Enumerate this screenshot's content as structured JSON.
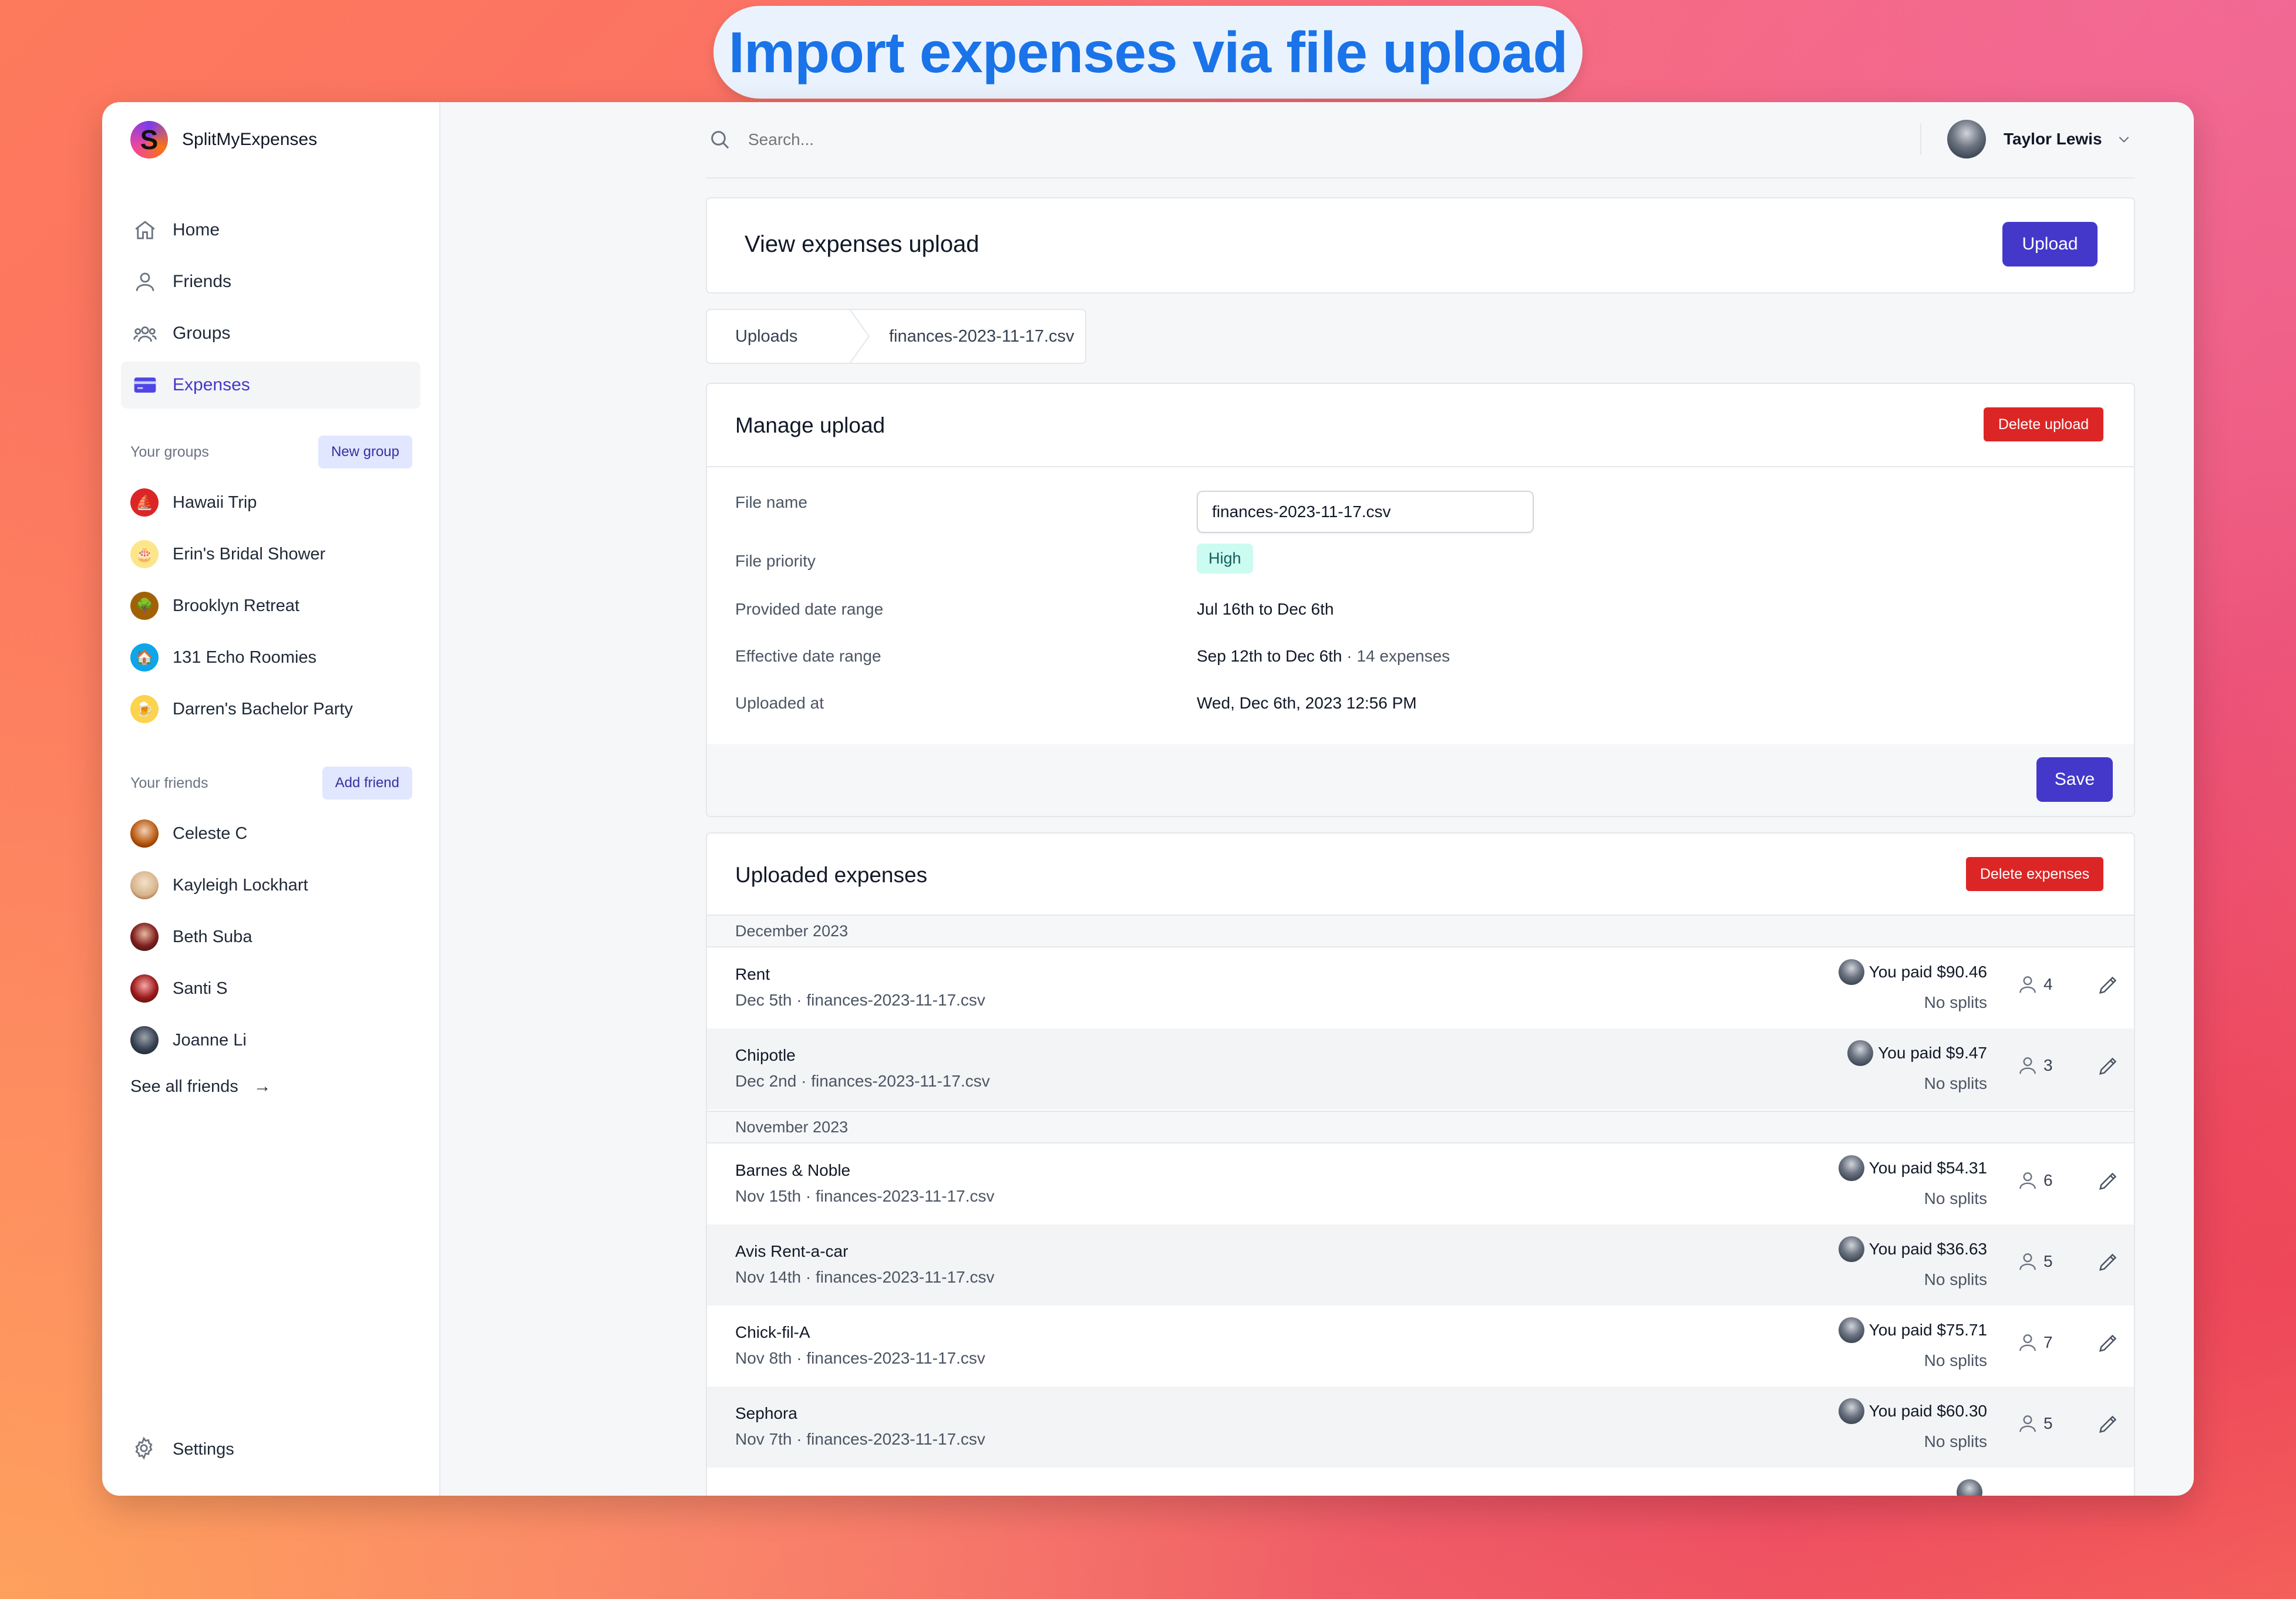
{
  "hero": {
    "title": "Import expenses via file upload"
  },
  "brand": {
    "logo_letter": "S",
    "name": "SplitMyExpenses"
  },
  "nav": [
    {
      "label": "Home",
      "icon": "home-icon",
      "active": false
    },
    {
      "label": "Friends",
      "icon": "user-icon",
      "active": false
    },
    {
      "label": "Groups",
      "icon": "users-icon",
      "active": false
    },
    {
      "label": "Expenses",
      "icon": "credit-card-icon",
      "active": true
    }
  ],
  "groups": {
    "label": "Your groups",
    "button": "New group",
    "items": [
      {
        "label": "Hawaii Trip",
        "color": "#dc2626",
        "glyph": "⛵"
      },
      {
        "label": "Erin's Bridal Shower",
        "color": "#fde68a",
        "glyph": "🎂"
      },
      {
        "label": "Brooklyn Retreat",
        "color": "#a16207",
        "glyph": "🌳"
      },
      {
        "label": "131 Echo Roomies",
        "color": "#0ea5e9",
        "glyph": "🏠"
      },
      {
        "label": "Darren's Bachelor Party",
        "color": "#fcd34d",
        "glyph": "🍺"
      }
    ]
  },
  "friends": {
    "label": "Your friends",
    "button": "Add friend",
    "items": [
      {
        "label": "Celeste C",
        "color": "#b45309"
      },
      {
        "label": "Kayleigh Lockhart",
        "color": "#d6b38a"
      },
      {
        "label": "Beth Suba",
        "color": "#7f1d1d"
      },
      {
        "label": "Santi S",
        "color": "#991b1b"
      },
      {
        "label": "Joanne Li",
        "color": "#374151"
      }
    ],
    "see_all": "See all friends",
    "see_all_arrow": "→"
  },
  "settings": {
    "label": "Settings"
  },
  "topbar": {
    "search_placeholder": "Search...",
    "user_name": "Taylor Lewis"
  },
  "view": {
    "title": "View expenses upload",
    "upload_button": "Upload"
  },
  "breadcrumb": {
    "root": "Uploads",
    "current": "finances-2023-11-17.csv"
  },
  "manage": {
    "title": "Manage upload",
    "delete_button": "Delete upload",
    "file_name_label": "File name",
    "file_name_value": "finances-2023-11-17.csv",
    "priority_label": "File priority",
    "priority_value": "High",
    "provided_label": "Provided date range",
    "provided_value": "Jul 16th to Dec 6th",
    "effective_label": "Effective date range",
    "effective_value": "Sep 12th to Dec 6th",
    "effective_count": "· 14 expenses",
    "uploaded_label": "Uploaded at",
    "uploaded_value": "Wed, Dec 6th, 2023 12:56 PM",
    "save_button": "Save"
  },
  "expenses": {
    "title": "Uploaded expenses",
    "delete_button": "Delete expenses",
    "months": [
      "December 2023",
      "November 2023"
    ],
    "rows": [
      {
        "name": "Rent",
        "date": "Dec 5th",
        "file": "finances-2023-11-17.csv",
        "paid": "You paid $90.46",
        "splits": "No splits",
        "people": "4"
      },
      {
        "name": "Chipotle",
        "date": "Dec 2nd",
        "file": "finances-2023-11-17.csv",
        "paid": "You paid $9.47",
        "splits": "No splits",
        "people": "3"
      },
      {
        "name": "Barnes & Noble",
        "date": "Nov 15th",
        "file": "finances-2023-11-17.csv",
        "paid": "You paid $54.31",
        "splits": "No splits",
        "people": "6"
      },
      {
        "name": "Avis Rent-a-car",
        "date": "Nov 14th",
        "file": "finances-2023-11-17.csv",
        "paid": "You paid $36.63",
        "splits": "No splits",
        "people": "5"
      },
      {
        "name": "Chick-fil-A",
        "date": "Nov 8th",
        "file": "finances-2023-11-17.csv",
        "paid": "You paid $75.71",
        "splits": "No splits",
        "people": "7"
      },
      {
        "name": "Sephora",
        "date": "Nov 7th",
        "file": "finances-2023-11-17.csv",
        "paid": "You paid $60.30",
        "splits": "No splits",
        "people": "5"
      }
    ],
    "separator": "·"
  },
  "colors": {
    "primary": "#4338ca",
    "danger": "#dc2626",
    "hero_text": "#1a73e8",
    "badge_bg": "#ccfbf1"
  }
}
